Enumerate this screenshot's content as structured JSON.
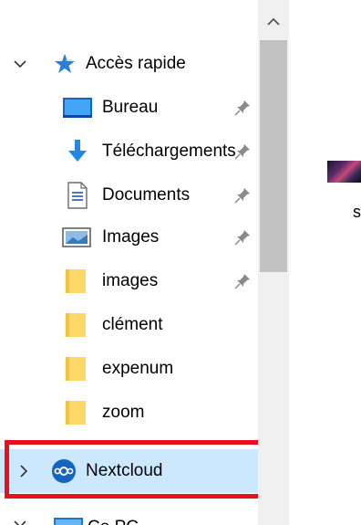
{
  "nav": {
    "quick_access": {
      "label": "Accès rapide",
      "expanded": true
    },
    "items": [
      {
        "label": "Bureau",
        "icon": "desktop-icon",
        "pinned": true
      },
      {
        "label": "Téléchargements",
        "icon": "downloads-icon",
        "pinned": true
      },
      {
        "label": "Documents",
        "icon": "documents-icon",
        "pinned": true
      },
      {
        "label": "Images",
        "icon": "pictures-icon",
        "pinned": true
      },
      {
        "label": "images",
        "icon": "folder-icon",
        "pinned": true
      },
      {
        "label": "clément",
        "icon": "folder-icon",
        "pinned": false
      },
      {
        "label": "expenum",
        "icon": "folder-icon",
        "pinned": false
      },
      {
        "label": "zoom",
        "icon": "folder-icon",
        "pinned": false
      }
    ],
    "nextcloud": {
      "label": "Nextcloud",
      "selected": true,
      "highlight_color": "#e8101f"
    },
    "this_pc": {
      "label": "Ce PC"
    }
  },
  "content": {
    "file_label": "s"
  },
  "colors": {
    "selection": "#cce8ff",
    "highlight": "#e8101f",
    "folder": "#ffd86a",
    "accent_blue": "#1e88e5"
  }
}
